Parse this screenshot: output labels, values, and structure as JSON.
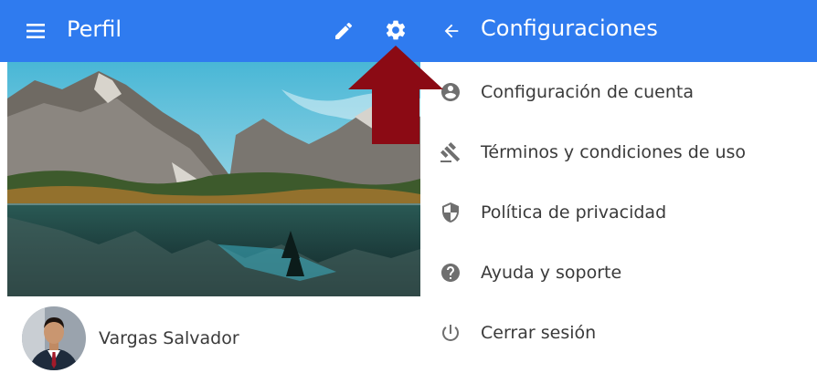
{
  "profile_screen": {
    "title": "Perfil",
    "menu_icon": "hamburger-menu-icon",
    "edit_icon": "pencil-icon",
    "settings_icon": "gear-icon",
    "user_name": "Vargas Salvador"
  },
  "settings_screen": {
    "title": "Configuraciones",
    "back_icon": "arrow-back-icon",
    "items": [
      {
        "icon": "account-circle-icon",
        "label": "Configuración de cuenta"
      },
      {
        "icon": "gavel-icon",
        "label": "Términos y condiciones de uso"
      },
      {
        "icon": "shield-icon",
        "label": "Política de privacidad"
      },
      {
        "icon": "help-circle-icon",
        "label": "Ayuda y soporte"
      },
      {
        "icon": "power-icon",
        "label": "Cerrar sesión"
      }
    ]
  },
  "colors": {
    "app_bar": "#2f7bef",
    "annotation_arrow": "#8b0a14",
    "text": "#3a3a3a",
    "menu_icon_gray": "#6f6f6f"
  }
}
